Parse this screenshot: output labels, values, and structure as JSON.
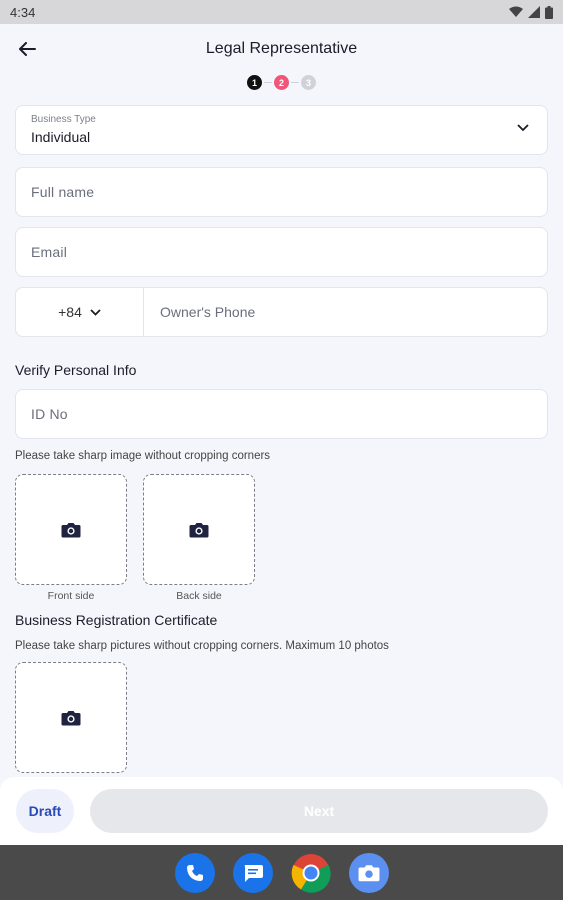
{
  "status_bar": {
    "time": "4:34"
  },
  "header": {
    "title": "Legal Representative"
  },
  "stepper": {
    "steps": [
      "1",
      "2",
      "3"
    ],
    "active_step": 2
  },
  "form": {
    "business_type_label": "Business Type",
    "business_type_value": "Individual",
    "full_name_placeholder": "Full name",
    "email_placeholder": "Email",
    "country_code": "+84",
    "phone_placeholder": "Owner's Phone"
  },
  "verify": {
    "title": "Verify Personal Info",
    "id_placeholder": "ID No",
    "hint": "Please take sharp image without cropping corners",
    "front_caption": "Front side",
    "back_caption": "Back side"
  },
  "brc": {
    "title": "Business Registration Certificate",
    "hint": "Please take sharp pictures without cropping corners. Maximum 10 photos"
  },
  "actions": {
    "draft_label": "Draft",
    "next_label": "Next"
  },
  "colors": {
    "accent": "#2b49b8",
    "active_step": "#f0557a",
    "disabled_button": "#e6e7ea",
    "background": "#f4f6fb"
  },
  "dock": {
    "apps": [
      "phone-icon",
      "messages-icon",
      "chrome-icon",
      "camera-icon"
    ]
  }
}
